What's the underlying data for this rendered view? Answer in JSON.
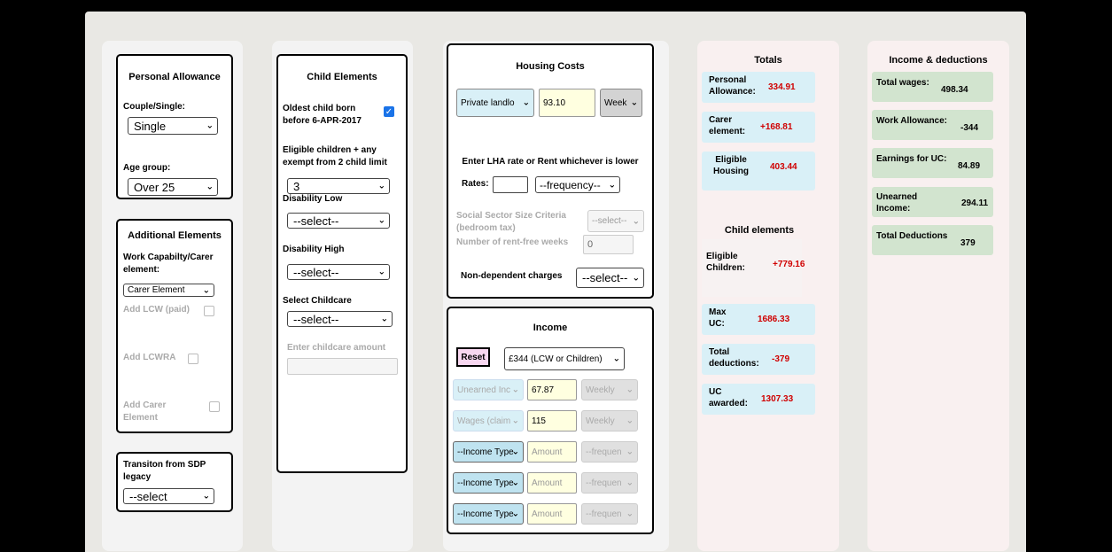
{
  "personal_allowance": {
    "title": "Personal Allowance",
    "couple_label": "Couple/Single:",
    "couple_value": "Single",
    "age_label": "Age group:",
    "age_value": "Over 25"
  },
  "additional": {
    "title": "Additional Elements",
    "capability_label": "Work Capabilty/Carer element:",
    "capability_value": "Carer Element",
    "lcw_label": "Add LCW (paid)",
    "lcwra_label": "Add LCWRA",
    "carer_label": "Add Carer Element"
  },
  "transition": {
    "label": "Transiton from SDP legacy",
    "value": "--select"
  },
  "child": {
    "title": "Child Elements",
    "oldest_label": "Oldest child born before 6-APR-2017",
    "oldest_checked": true,
    "eligible_label": "Eligible children + any exempt from 2 child limit",
    "eligible_value": "3",
    "dis_low_label": "Disability Low",
    "dis_low_value": "--select--",
    "dis_high_label": "Disability High",
    "dis_high_value": "--select--",
    "childcare_label": "Select Childcare",
    "childcare_value": "--select--",
    "childcare_amount_label": "Enter childcare amount"
  },
  "housing": {
    "title": "Housing Costs",
    "landlord_value": "Private landlo",
    "rent_value": "93.10",
    "period_value": "Week",
    "lha_label": "Enter LHA rate or Rent whichever is lower",
    "rates_label": "Rates:",
    "rates_freq": "--frequency--",
    "ssc_label": "Social Sector Size Criteria (bedroom tax)",
    "ssc_value": "--select--",
    "rentfree_label": "Number of rent-free weeks",
    "rentfree_value": "0",
    "nondep_label": "Non-dependent charges",
    "nondep_value": "--select--"
  },
  "income": {
    "title": "Income",
    "reset_label": "Reset",
    "allowance_value": "£344 (LCW or Children)",
    "rows": [
      {
        "type": "Unearned Inc",
        "amount": "67.87",
        "freq": "Weekly"
      },
      {
        "type": "Wages (claim",
        "amount": "115",
        "freq": "Weekly"
      },
      {
        "type": "--Income Type",
        "amount": "Amount",
        "freq": "--frequen"
      },
      {
        "type": "--Income Type",
        "amount": "Amount",
        "freq": "--frequen"
      },
      {
        "type": "--Income Type",
        "amount": "Amount",
        "freq": "--frequen"
      }
    ]
  },
  "totals": {
    "title": "Totals",
    "personal_label": "Personal Allowance:",
    "personal_value": "334.91",
    "carer_label": "Carer element:",
    "carer_value": "+168.81",
    "housing_label": "Eligible Housing",
    "housing_value": "403.44",
    "child_title": "Child elements",
    "children_label": "Eligible Children:",
    "children_value": "+779.16",
    "maxuc_label": "Max UC:",
    "maxuc_value": "1686.33",
    "deductions_label": "Total deductions:",
    "deductions_value": "-379",
    "awarded_label": "UC awarded:",
    "awarded_value": "1307.33"
  },
  "income_deductions": {
    "title": "Income & deductions",
    "wages_label": "Total wages:",
    "wages_value": "498.34",
    "work_allow_label": "Work Allowance:",
    "work_allow_value": "-344",
    "earnings_label": "Earnings for UC:",
    "earnings_value": "84.89",
    "unearned_label": "Unearned Income:",
    "unearned_value": "294.11",
    "total_ded_label": "Total Deductions",
    "total_ded_value": "379"
  }
}
